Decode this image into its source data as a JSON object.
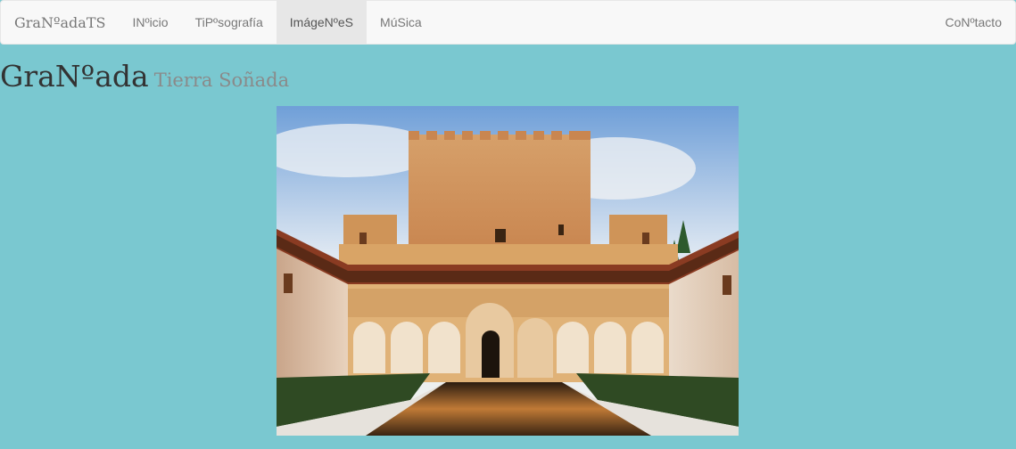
{
  "navbar": {
    "brand": "GraNºadaTS",
    "items": [
      {
        "label": "INºicio",
        "active": false
      },
      {
        "label": "TiPºsografía",
        "active": false
      },
      {
        "label": "ImágeNºeS",
        "active": true
      },
      {
        "label": "MúSica",
        "active": false
      }
    ],
    "right_item": "CoNºtacto"
  },
  "header": {
    "title": "GraNºada",
    "subtitle": "Tierra Soñada"
  },
  "photo": {
    "subject": "alhambra-court-of-myrtles-photo"
  },
  "colors": {
    "page_background": "#7ac8d0",
    "navbar_background": "#f8f8f8",
    "active_tab_background": "#e7e7e7"
  }
}
